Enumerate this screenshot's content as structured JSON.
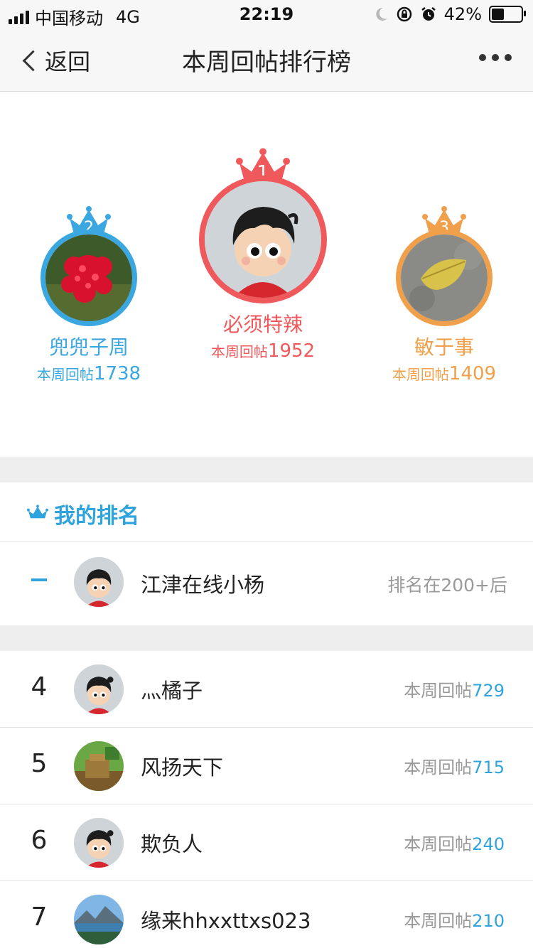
{
  "status_bar": {
    "carrier": "中国移动",
    "network": "4G",
    "time": "22:19",
    "battery_text": "42%",
    "battery_level": 0.42
  },
  "nav": {
    "back_label": "返回",
    "title": "本周回帖排行榜"
  },
  "podium": [
    {
      "rank": "2",
      "name": "兜兜子周",
      "stat_label": "本周回帖",
      "count": "1738",
      "color": "#3aa7e0",
      "avatar": "red-flower"
    },
    {
      "rank": "1",
      "name": "必须特辣",
      "stat_label": "本周回帖",
      "count": "1952",
      "color": "#f0595b",
      "avatar": "cartoon-boy"
    },
    {
      "rank": "3",
      "name": "敏于事",
      "stat_label": "本周回帖",
      "count": "1409",
      "color": "#f0a04b",
      "avatar": "leaf"
    }
  ],
  "my_rank": {
    "title": "我的排名",
    "name": "江津在线小杨",
    "rank_text": "排名在200+后"
  },
  "list": [
    {
      "rank": "4",
      "name": "灬橘子",
      "stat_label": "本周回帖",
      "count": "729",
      "avatar": "cartoon-girl"
    },
    {
      "rank": "5",
      "name": "风扬天下",
      "stat_label": "本周回帖",
      "count": "715",
      "avatar": "game-scene"
    },
    {
      "rank": "6",
      "name": "欺负人",
      "stat_label": "本周回帖",
      "count": "240",
      "avatar": "cartoon-girl"
    },
    {
      "rank": "7",
      "name": "缘来hhxxttxs023",
      "stat_label": "本周回帖",
      "count": "210",
      "avatar": "mountain-lake"
    }
  ]
}
